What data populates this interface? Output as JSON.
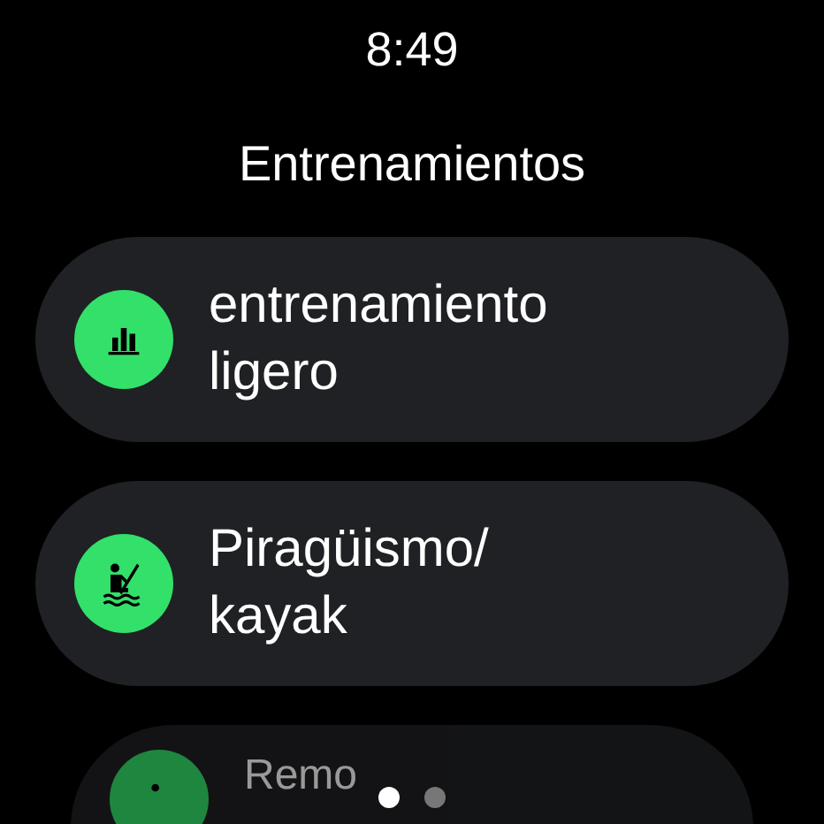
{
  "time": "8:49",
  "title": "Entrenamientos",
  "items": [
    {
      "label": "entrenamiento ligero",
      "kind": "chart"
    },
    {
      "label": "Piragüismo/ kayak",
      "kind": "kayak"
    },
    {
      "label": "Remo",
      "kind": "rowing"
    }
  ],
  "pages": [
    {
      "selected": true
    },
    {
      "selected": false
    }
  ]
}
